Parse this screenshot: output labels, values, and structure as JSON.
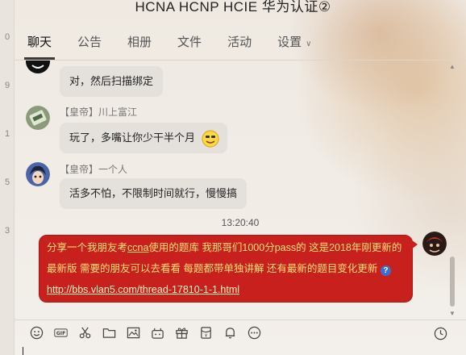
{
  "window": {
    "title": "HCNA HCNP HCIE 华为认证②"
  },
  "left_strip": [
    "0",
    "9",
    "1",
    "5",
    "3"
  ],
  "tabs": [
    {
      "label": "聊天"
    },
    {
      "label": "公告"
    },
    {
      "label": "相册"
    },
    {
      "label": "文件"
    },
    {
      "label": "活动"
    },
    {
      "label": "设置"
    }
  ],
  "messages": [
    {
      "text": "对，然后扫描绑定"
    },
    {
      "sender": "【皇帝】川上富江",
      "text": "玩了，多嘴让你少干半个月"
    },
    {
      "sender": "【皇帝】一个人",
      "text": "活多不怕，不限制时间就行，慢慢搞"
    }
  ],
  "timestamp": "13:20:40",
  "my_message": {
    "part1": "分享一个我朋友考",
    "underlined": "ccna",
    "part2": "使用的题库 我那哥们1000分pass的 这是2018年刚更新的最新版 需要的朋友可以去看看 每题都带单独讲解 还有最新的题目变化更新",
    "link": "http://bbs.vlan5.com/thread-17810-1-1.html"
  },
  "colors": {
    "my_bubble": "#c7201d",
    "my_text": "#ffe07a",
    "bubble_gray": "#e4e1dd"
  }
}
